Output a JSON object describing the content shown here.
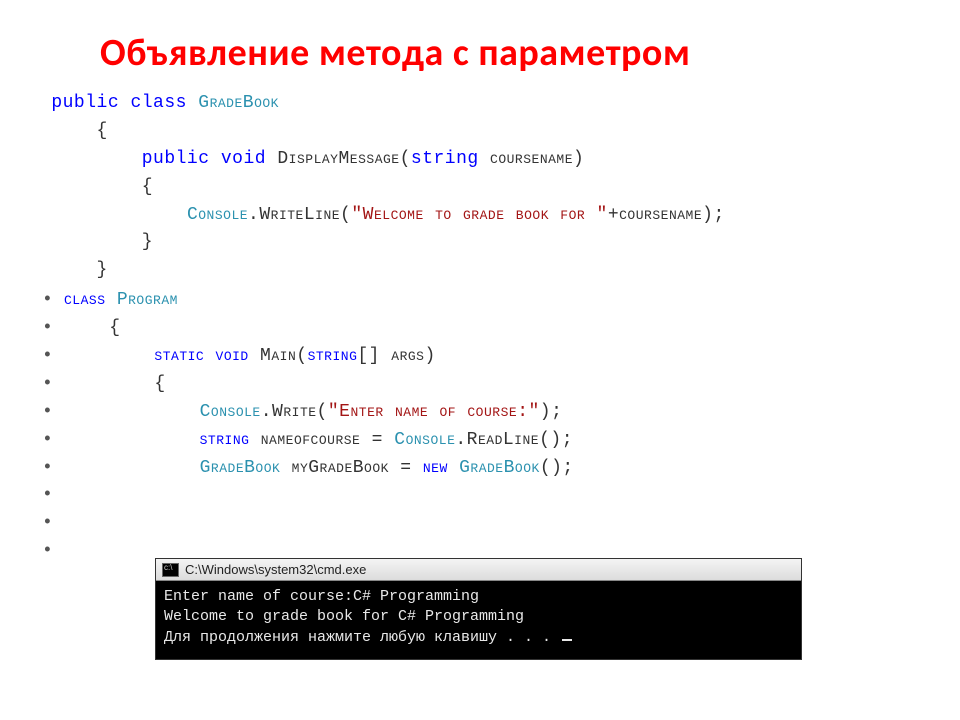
{
  "title": "Объявление метода с параметром",
  "code_top": {
    "l1": {
      "kw1": "public",
      "kw2": "class",
      "type": "GradeBook"
    },
    "l2": "{",
    "l3": {
      "kw1": "public",
      "kw2": "void",
      "name": "DisplayMessage(",
      "kw3": "string",
      "rest": " coursename)"
    },
    "l4": "{",
    "l5": {
      "type": "Console",
      "call": ".WriteLine(",
      "str": "\"Welcome to grade book for \"",
      "rest": "+coursename);"
    },
    "l6": "}",
    "l7": "}"
  },
  "bullets": [
    {
      "pre": "",
      "parts": [
        {
          "t": "class ",
          "c": "kw-blue"
        },
        {
          "t": "Program",
          "c": "typename"
        }
      ]
    },
    {
      "pre": "    ",
      "parts": [
        {
          "t": "{",
          "c": "txt"
        }
      ]
    },
    {
      "pre": "        ",
      "parts": [
        {
          "t": "static ",
          "c": "kw-blue"
        },
        {
          "t": "void ",
          "c": "kw-blue"
        },
        {
          "t": "Main(",
          "c": "txt"
        },
        {
          "t": "string",
          "c": "kw-blue"
        },
        {
          "t": "[] args)",
          "c": "txt"
        }
      ]
    },
    {
      "pre": "        ",
      "parts": [
        {
          "t": "{",
          "c": "txt"
        }
      ]
    },
    {
      "pre": "            ",
      "parts": [
        {
          "t": "Console",
          "c": "typename"
        },
        {
          "t": ".Write(",
          "c": "txt"
        },
        {
          "t": "\"Enter name of course:\"",
          "c": "str"
        },
        {
          "t": ");",
          "c": "txt"
        }
      ]
    },
    {
      "pre": "            ",
      "parts": [
        {
          "t": "string ",
          "c": "kw-blue"
        },
        {
          "t": "nameofcourse = ",
          "c": "txt"
        },
        {
          "t": "Console",
          "c": "typename"
        },
        {
          "t": ".ReadLine();",
          "c": "txt"
        }
      ]
    },
    {
      "pre": "            ",
      "parts": [
        {
          "t": "GradeBook ",
          "c": "typename"
        },
        {
          "t": "myGradeBook = ",
          "c": "txt"
        },
        {
          "t": "new ",
          "c": "kw-blue"
        },
        {
          "t": "GradeBook",
          "c": "typename"
        },
        {
          "t": "();",
          "c": "txt"
        }
      ]
    },
    {
      "pre": "",
      "parts": []
    },
    {
      "pre": "",
      "parts": []
    },
    {
      "pre": "",
      "parts": []
    }
  ],
  "console": {
    "title": "C:\\Windows\\system32\\cmd.exe",
    "icon_label": "cmd-icon",
    "lines": [
      "Enter name of course:C# Programming",
      "Welcome to grade book for C# Programming",
      "Для продолжения нажмите любую клавишу . . . "
    ]
  }
}
